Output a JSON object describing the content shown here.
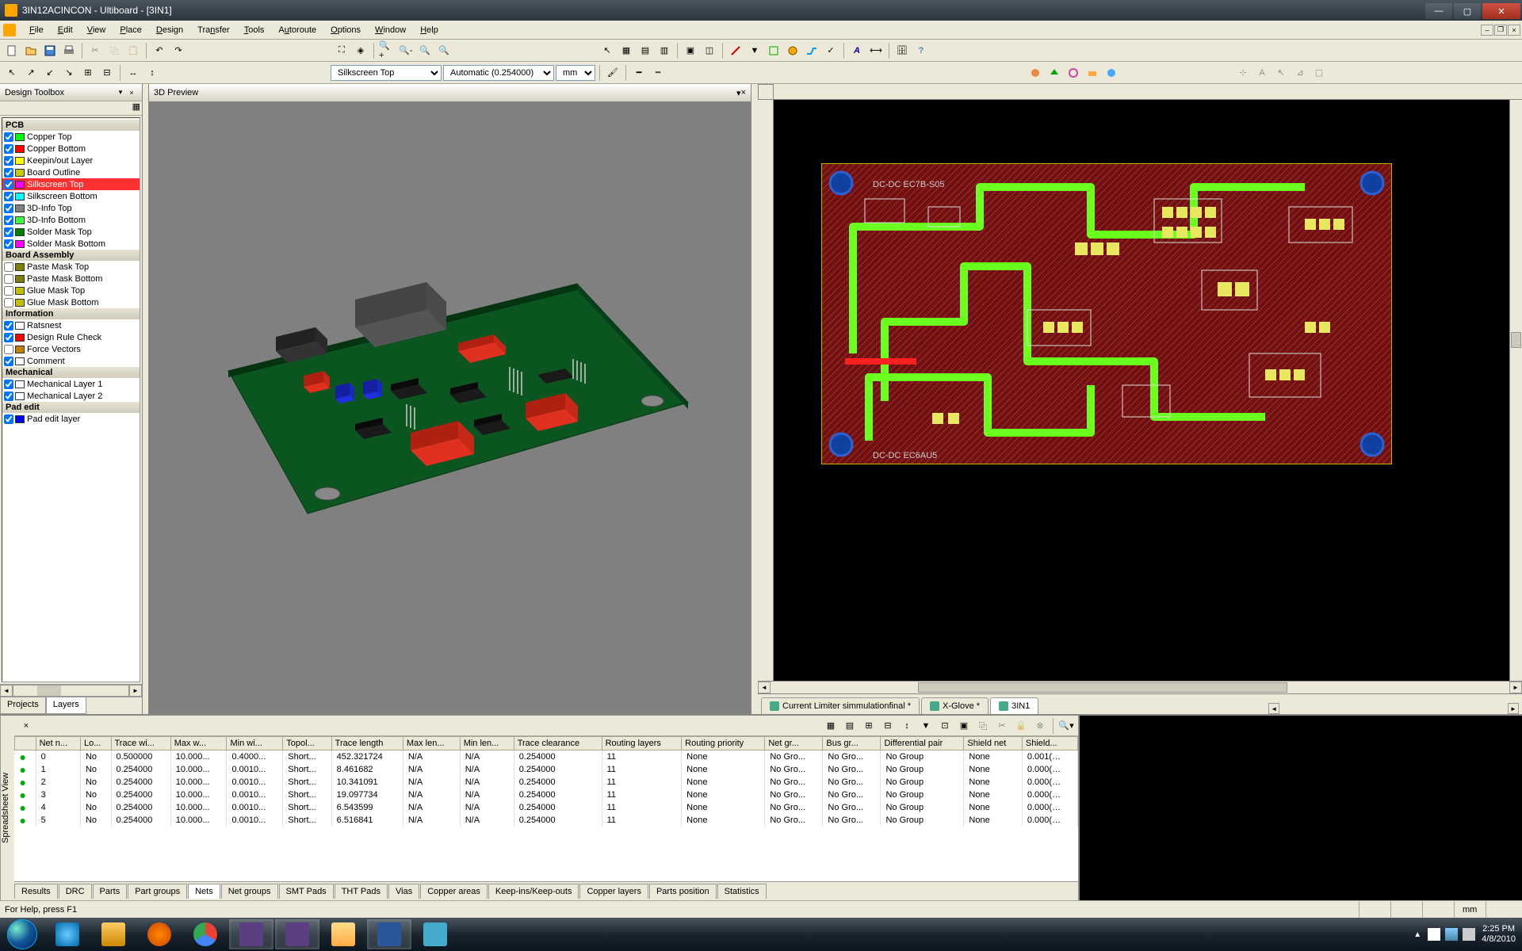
{
  "title": "3IN12ACINCON - Ultiboard - [3IN1]",
  "menu": [
    "File",
    "Edit",
    "View",
    "Place",
    "Design",
    "Transfer",
    "Tools",
    "Autoroute",
    "Options",
    "Window",
    "Help"
  ],
  "menu_underline_idx": [
    0,
    0,
    0,
    0,
    0,
    3,
    0,
    1,
    0,
    0,
    0
  ],
  "layer_select": "Silkscreen Top",
  "grid_select": "Automatic (0.254000)",
  "unit_select": "mm",
  "design_toolbox_title": "Design Toolbox",
  "preview_title": "3D Preview",
  "layer_groups": [
    {
      "name": "PCB",
      "items": [
        {
          "label": "Copper Top",
          "color": "#00ff00",
          "checked": true
        },
        {
          "label": "Copper Bottom",
          "color": "#ff0000",
          "checked": true
        },
        {
          "label": "Keepin/out Layer",
          "color": "#ffff00",
          "checked": true
        },
        {
          "label": "Board Outline",
          "color": "#c8c800",
          "checked": true
        },
        {
          "label": "Silkscreen Top",
          "color": "#ff00ff",
          "checked": true,
          "selected": true
        },
        {
          "label": "Silkscreen Bottom",
          "color": "#00ffff",
          "checked": true
        },
        {
          "label": "3D-Info Top",
          "color": "#808080",
          "checked": true
        },
        {
          "label": "3D-Info Bottom",
          "color": "#40ff40",
          "checked": true
        },
        {
          "label": "Solder Mask Top",
          "color": "#008000",
          "checked": true
        },
        {
          "label": "Solder Mask Bottom",
          "color": "#ff00ff",
          "checked": true
        }
      ]
    },
    {
      "name": "Board Assembly",
      "items": [
        {
          "label": "Paste Mask Top",
          "color": "#808000",
          "checked": false
        },
        {
          "label": "Paste Mask Bottom",
          "color": "#808000",
          "checked": false
        },
        {
          "label": "Glue Mask Top",
          "color": "#c0c000",
          "checked": false
        },
        {
          "label": "Glue Mask Bottom",
          "color": "#c0c000",
          "checked": false
        }
      ]
    },
    {
      "name": "Information",
      "items": [
        {
          "label": "Ratsnest",
          "color": "",
          "checked": true
        },
        {
          "label": "Design Rule Check",
          "color": "#ff0000",
          "checked": true
        },
        {
          "label": "Force Vectors",
          "color": "#c08000",
          "checked": false
        },
        {
          "label": "Comment",
          "color": "",
          "checked": true
        }
      ]
    },
    {
      "name": "Mechanical",
      "items": [
        {
          "label": "Mechanical Layer 1",
          "color": "",
          "checked": true
        },
        {
          "label": "Mechanical Layer 2",
          "color": "",
          "checked": true
        }
      ]
    },
    {
      "name": "Pad edit",
      "items": [
        {
          "label": "Pad edit layer",
          "color": "#0000ff",
          "checked": true
        }
      ]
    }
  ],
  "design_tabs": [
    "Projects",
    "Layers"
  ],
  "doc_tabs": [
    "Current Limiter simmulationfinal *",
    "X-Glove *",
    "3IN1"
  ],
  "doc_active": 2,
  "sheet_columns": [
    "",
    "Net n...",
    "Lo...",
    "Trace wi...",
    "Max w...",
    "Min wi...",
    "Topol...",
    "Trace length",
    "Max len...",
    "Min len...",
    "Trace clearance",
    "Routing layers",
    "Routing priority",
    "Net gr...",
    "Bus gr...",
    "Differential pair",
    "Shield net",
    "Shield..."
  ],
  "sheet_rows": [
    [
      "●",
      "0",
      "No",
      "0.500000",
      "10.000...",
      "0.4000...",
      "Short...",
      "452.321724",
      "N/A",
      "N/A",
      "0.254000",
      "11",
      "None",
      "No Gro...",
      "No Gro...",
      "No Group",
      "None",
      "0.001(…"
    ],
    [
      "●",
      "1",
      "No",
      "0.254000",
      "10.000...",
      "0.0010...",
      "Short...",
      "8.461682",
      "N/A",
      "N/A",
      "0.254000",
      "11",
      "None",
      "No Gro...",
      "No Gro...",
      "No Group",
      "None",
      "0.000(…"
    ],
    [
      "●",
      "2",
      "No",
      "0.254000",
      "10.000...",
      "0.0010...",
      "Short...",
      "10.341091",
      "N/A",
      "N/A",
      "0.254000",
      "11",
      "None",
      "No Gro...",
      "No Gro...",
      "No Group",
      "None",
      "0.000(…"
    ],
    [
      "●",
      "3",
      "No",
      "0.254000",
      "10.000...",
      "0.0010...",
      "Short...",
      "19.097734",
      "N/A",
      "N/A",
      "0.254000",
      "11",
      "None",
      "No Gro...",
      "No Gro...",
      "No Group",
      "None",
      "0.000(…"
    ],
    [
      "●",
      "4",
      "No",
      "0.254000",
      "10.000...",
      "0.0010...",
      "Short...",
      "6.543599",
      "N/A",
      "N/A",
      "0.254000",
      "11",
      "None",
      "No Gro...",
      "No Gro...",
      "No Group",
      "None",
      "0.000(…"
    ],
    [
      "●",
      "5",
      "No",
      "0.254000",
      "10.000...",
      "0.0010...",
      "Short...",
      "6.516841",
      "N/A",
      "N/A",
      "0.254000",
      "11",
      "None",
      "No Gro...",
      "No Gro...",
      "No Group",
      "None",
      "0.000(…"
    ]
  ],
  "sheet_tabs": [
    "Results",
    "DRC",
    "Parts",
    "Part groups",
    "Nets",
    "Net groups",
    "SMT Pads",
    "THT Pads",
    "Vias",
    "Copper areas",
    "Keep-ins/Keep-outs",
    "Copper layers",
    "Parts position",
    "Statistics"
  ],
  "sheet_tab_active": 4,
  "spreadsheet_label": "Spreadsheet View",
  "status_help": "For Help, press F1",
  "status_unit": "mm",
  "clock_time": "2:25 PM",
  "clock_date": "4/8/2010"
}
